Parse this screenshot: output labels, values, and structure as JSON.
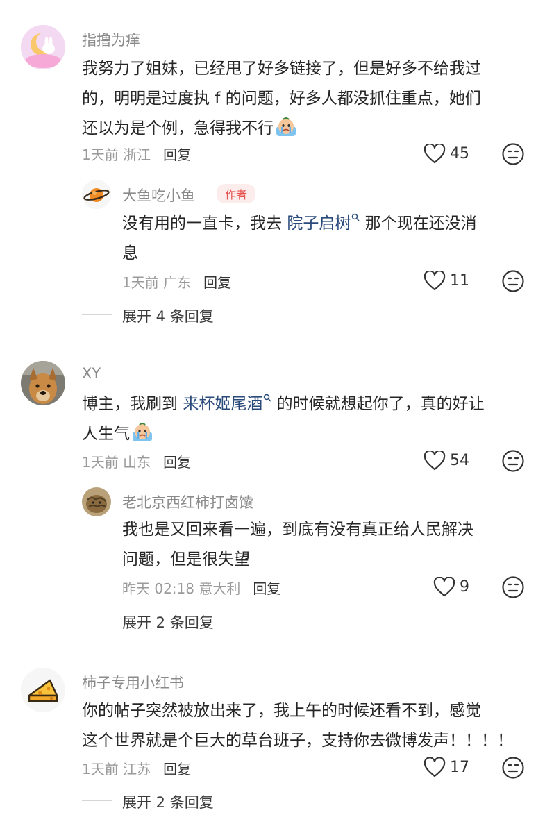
{
  "comments": [
    {
      "username": "指撸为痒",
      "text_lines": [
        "我努力了姐妹，已经甩了好多链接了，但是好多不给我过",
        "的，明明是过度执 f 的问题，好多人都没抓住重点，她们",
        "还以为是个例，急得我不行"
      ],
      "time": "1天前",
      "location": "浙江",
      "reply_label": "回复",
      "likes": "45",
      "reply": {
        "username": "大鱼吃小鱼",
        "author_tag": "作者",
        "text_line1_pre": "没有用的一直卡，我去 ",
        "text_line1_link": "院子启树",
        "text_line1_post": " 那个现在还没消",
        "text_line2": "息",
        "time": "1天前",
        "location": "广东",
        "reply_label": "回复",
        "likes": "11"
      },
      "expand_label": "展开 4 条回复"
    },
    {
      "username": "XY",
      "text_line1_pre": "博主，我刷到 ",
      "text_line1_link": "来杯姬尾酒",
      "text_line1_post": " 的时候就想起你了，真的好让",
      "text_line2": "人生气",
      "time": "1天前",
      "location": "山东",
      "reply_label": "回复",
      "likes": "54",
      "reply": {
        "username": "老北京西红柿打卤馕",
        "text_lines": [
          "我也是又回来看一遍，到底有没有真正给人民解决",
          "问题，但是很失望"
        ],
        "time": "昨天 02:18",
        "location": "意大利",
        "reply_label": "回复",
        "likes": "9"
      },
      "expand_label": "展开 2 条回复"
    },
    {
      "username": "柿子专用小红书",
      "text_lines": [
        "你的帖子突然被放出来了，我上午的时候还看不到，感觉",
        "这个世界就是个巨大的草台班子，支持你去微博发声！！！！"
      ],
      "time": "1天前",
      "location": "江苏",
      "reply_label": "回复",
      "likes": "17",
      "expand_label": "展开 2 条回复"
    }
  ],
  "colors": {
    "link": "#2a4a7b",
    "author_tag": "#e6534f",
    "meta": "#9a9a9a"
  },
  "icons": {
    "like": "heart-outline-icon",
    "dislike": "neutral-face-icon",
    "search_hint": "search-small-icon",
    "emoji": "crying-face-emoji"
  }
}
